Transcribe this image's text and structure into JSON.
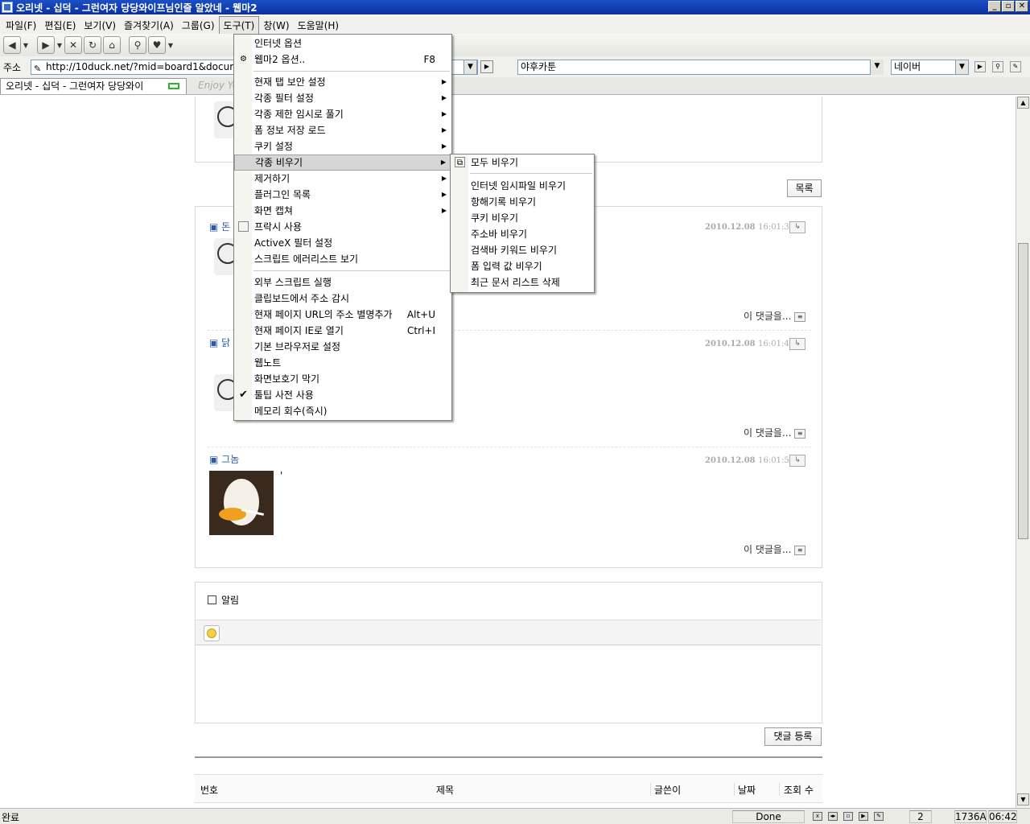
{
  "window": {
    "title": "오리넷 - 십덕 - 그런여자 당당와이프님인줄 알았네 - 웹마2"
  },
  "menubar": {
    "items": [
      "파일(F)",
      "편집(E)",
      "보기(V)",
      "즐겨찾기(A)",
      "그룹(G)",
      "도구(T)",
      "창(W)",
      "도움말(H)"
    ]
  },
  "address": {
    "label": "주소",
    "url": "http://10duck.net/?mid=board1&document_srl=...",
    "search_value": "야후카툰",
    "engine": "네이버"
  },
  "tabs": {
    "active": "오리넷 - 십덕 - 그런여자 당당와이",
    "inactive": "Enjoy Yo"
  },
  "tools_menu": {
    "items": [
      {
        "label": "인터넷 옵션",
        "shortcut": ""
      },
      {
        "label": "웹마2 옵션..",
        "shortcut": "F8"
      },
      {
        "label": "현재 탭 보안 설정",
        "shortcut": ""
      },
      {
        "label": "각종 필터 설정",
        "shortcut": ""
      },
      {
        "label": "각종 제한 임시로 풀기",
        "shortcut": ""
      },
      {
        "label": "폼 정보 저장 로드",
        "shortcut": ""
      },
      {
        "label": "쿠키 설정",
        "shortcut": ""
      },
      {
        "label": "각종 비우기",
        "shortcut": ""
      },
      {
        "label": "제거하기",
        "shortcut": ""
      },
      {
        "label": "플러그인 목록",
        "shortcut": ""
      },
      {
        "label": "화면 캡쳐",
        "shortcut": ""
      },
      {
        "label": "프락시 사용",
        "shortcut": ""
      },
      {
        "label": "ActiveX 필터 설정",
        "shortcut": ""
      },
      {
        "label": "스크립트 에러리스트 보기",
        "shortcut": ""
      },
      {
        "label": "외부 스크립트 실행",
        "shortcut": ""
      },
      {
        "label": "클립보드에서 주소 감시",
        "shortcut": ""
      },
      {
        "label": "현재 페이지 URL의 주소 별명추가",
        "shortcut": "Alt+U"
      },
      {
        "label": "현재 페이지 IE로 열기",
        "shortcut": "Ctrl+I"
      },
      {
        "label": "기본 브라우저로 설정",
        "shortcut": ""
      },
      {
        "label": "웹노트",
        "shortcut": ""
      },
      {
        "label": "화면보호기 막기",
        "shortcut": ""
      },
      {
        "label": "툴팁 사전 사용",
        "shortcut": ""
      },
      {
        "label": "메모리 회수(즉시)",
        "shortcut": ""
      }
    ]
  },
  "clear_submenu": {
    "items": [
      "모두 비우기",
      "인터넷 임시파일 비우기",
      "항해기록 비우기",
      "쿠키 비우기",
      "주소바 비우기",
      "검색바 키워드 비우기",
      "폼 입력 값 비우기",
      "최근 문서 리스트 삭제"
    ]
  },
  "page": {
    "list_button": "목록",
    "comments": [
      {
        "author": "돈",
        "date": "2010.12.08",
        "time": "16:01:32",
        "reply": "이 댓글을..."
      },
      {
        "author": "닭",
        "date": "2010.12.08",
        "time": "16:01:48",
        "reply": "이 댓글을..."
      },
      {
        "author": "그놈",
        "date": "2010.12.08",
        "time": "16:01:51",
        "reply": "이 댓글을...",
        "text": "'"
      }
    ],
    "notify_label": "알림",
    "submit_button": "댓글 등록",
    "table_headers": {
      "no": "번호",
      "title": "제목",
      "author": "글쓴이",
      "date": "날짜",
      "views": "조회 수"
    }
  },
  "statusbar": {
    "left": "완료",
    "state": "Done",
    "count": "2",
    "memory": "1736A",
    "clock": "06:42"
  }
}
